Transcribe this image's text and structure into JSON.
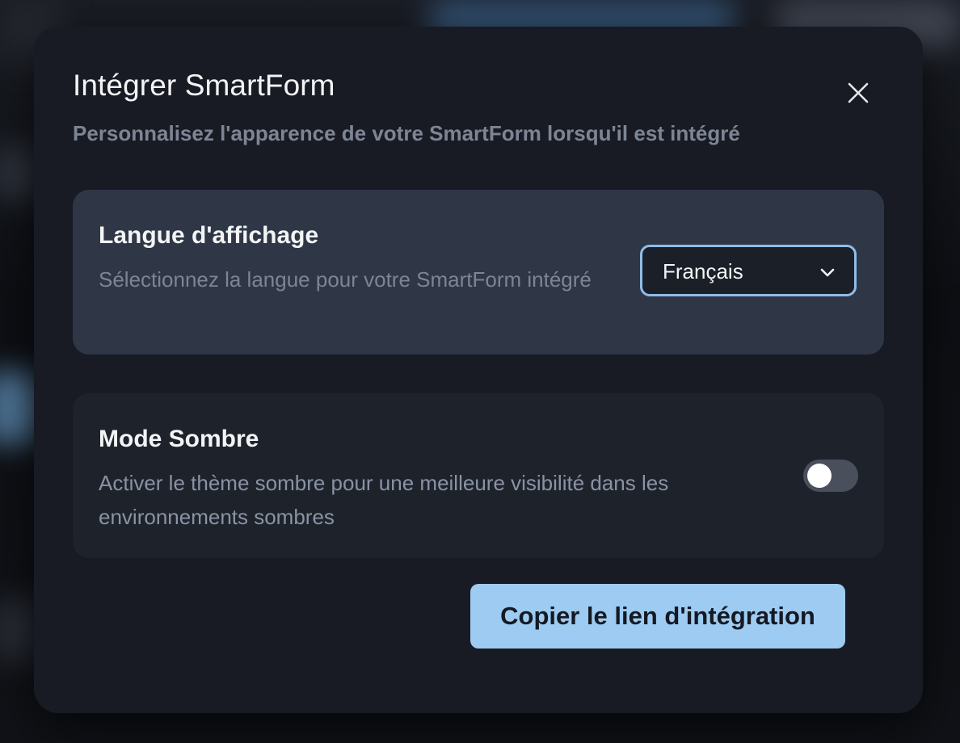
{
  "modal": {
    "title": "Intégrer SmartForm",
    "subtitle": "Personnalisez l'apparence de votre SmartForm lorsqu'il est intégré",
    "close_icon": "close-icon"
  },
  "language": {
    "title": "Langue d'affichage",
    "description": "Sélectionnez la langue pour votre SmartForm intégré",
    "selected": "Français",
    "chevron_icon": "chevron-down-icon"
  },
  "dark_mode": {
    "title": "Mode Sombre",
    "description": "Activer le thème sombre pour une meilleure visibilité dans les environnements sombres",
    "enabled": false
  },
  "actions": {
    "copy_label": "Copier le lien d'intégration"
  },
  "colors": {
    "modal_bg": "#181b23",
    "accent": "#9dcbf1",
    "select_border": "#8fbde8",
    "toggle_off": "#4a4f5c"
  }
}
